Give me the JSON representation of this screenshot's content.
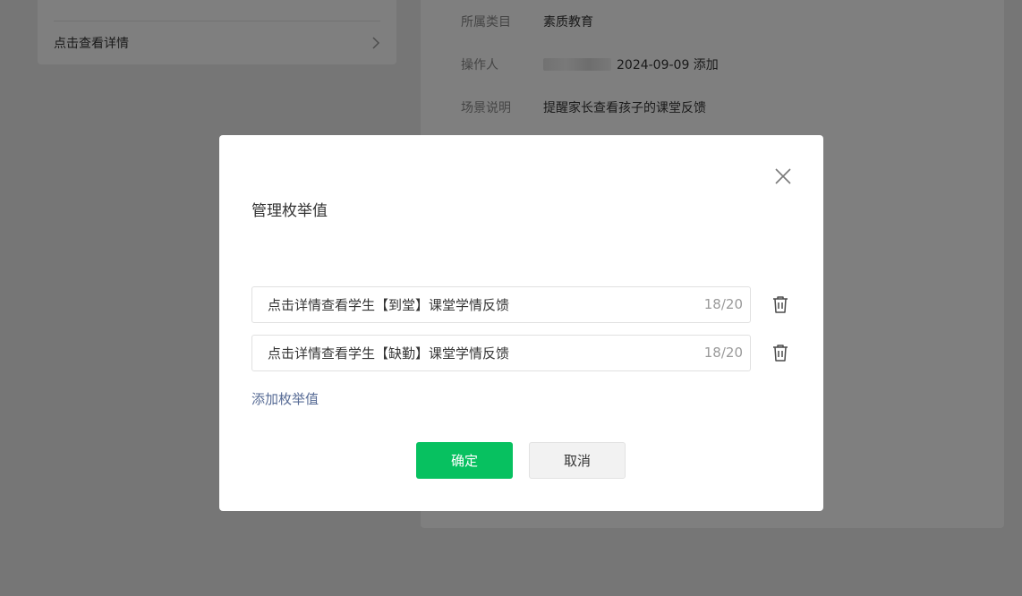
{
  "background": {
    "left_card": {
      "detail_link": "点击查看详情"
    },
    "info": [
      {
        "label": "所属类目",
        "value": "素质教育"
      },
      {
        "label": "操作人",
        "value": "2024-09-09 添加"
      },
      {
        "label": "场景说明",
        "value": "提醒家长查看孩子的课堂反馈"
      }
    ]
  },
  "dialog": {
    "title": "管理枚举值",
    "items": [
      {
        "value": "点击详情查看学生【到堂】课堂学情反馈",
        "count": "18/20"
      },
      {
        "value": "点击详情查看学生【缺勤】课堂学情反馈",
        "count": "18/20"
      }
    ],
    "add_label": "添加枚举值",
    "confirm_label": "确定",
    "cancel_label": "取消"
  },
  "colors": {
    "primary": "#07c160",
    "link": "#576b95",
    "mask": "rgba(0,0,0,0.5)"
  },
  "icons": [
    "chevron-right-icon",
    "close-icon",
    "trash-icon"
  ]
}
